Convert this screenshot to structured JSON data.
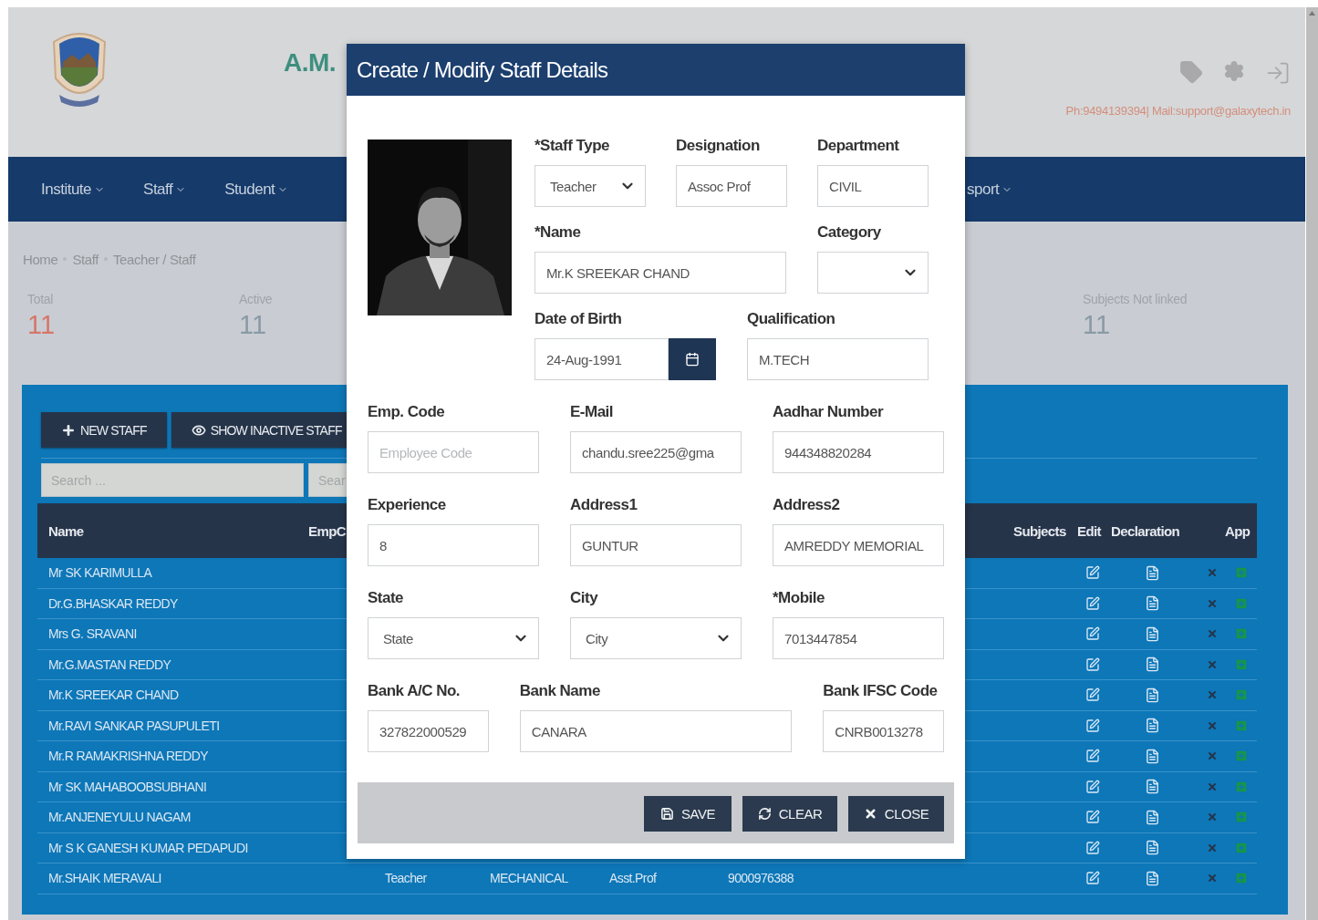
{
  "header": {
    "school_name": "A.M.",
    "contact": "Ph:9494139394| Mail:support@galaxytech.in"
  },
  "nav": [
    {
      "label": "Institute"
    },
    {
      "label": "Staff"
    },
    {
      "label": "Student"
    },
    {
      "label": "sport"
    }
  ],
  "breadcrumb": [
    "Home",
    "Staff",
    "Teacher / Staff"
  ],
  "stats": [
    {
      "label": "Total",
      "value": "11",
      "kind": "alert"
    },
    {
      "label": "Active",
      "value": "11",
      "kind": "plain"
    },
    {
      "label": "Subjects Not linked",
      "value": "11",
      "kind": "plain"
    }
  ],
  "toolbar": [
    {
      "label": "NEW STAFF",
      "kind": "new"
    },
    {
      "label": "SHOW INACTIVE STAFF",
      "kind": "show"
    }
  ],
  "search_fields": [
    {
      "placeholder": "Search ..."
    },
    {
      "placeholder": "Sear"
    }
  ],
  "table": {
    "columns_left": [
      "Name",
      "EmpC"
    ],
    "columns_right": [
      "Subjects",
      "Edit",
      "Declaration",
      "App"
    ],
    "rows": [
      {
        "name": "Mr SK KARIMULLA"
      },
      {
        "name": "Dr.G.BHASKAR REDDY"
      },
      {
        "name": "Mrs G. SRAVANI"
      },
      {
        "name": "Mr.G.MASTAN REDDY"
      },
      {
        "name": "Mr.K SREEKAR CHAND"
      },
      {
        "name": "Mr.RAVI SANKAR PASUPULETI"
      },
      {
        "name": "Mr.R RAMAKRISHNA REDDY"
      },
      {
        "name": "Mr SK MAHABOOBSUBHANI"
      },
      {
        "name": "Mr.ANJENEYULU NAGAM"
      },
      {
        "name": "Mr S K GANESH KUMAR PEDAPUDI"
      },
      {
        "name": "Mr.SHAIK MERAVALI",
        "cells": [
          "Teacher",
          "MECHANICAL",
          "Asst.Prof",
          "9000976388"
        ]
      }
    ]
  },
  "modal": {
    "title": "Create / Modify Staff Details",
    "top_rows": [
      [
        {
          "label": "*Staff Type",
          "kind": "select",
          "value": "Teacher"
        },
        {
          "label": "Designation",
          "kind": "text",
          "value": "Assoc Prof"
        },
        {
          "label": "Department",
          "kind": "text",
          "value": "CIVIL"
        }
      ],
      [
        {
          "label": "*Name",
          "kind": "text",
          "value": "Mr.K SREEKAR CHAND"
        },
        {
          "label": "Category",
          "kind": "select"
        }
      ],
      [
        {
          "label": "Date of Birth",
          "kind": "date",
          "value": "24-Aug-1991"
        },
        {
          "label": "Qualification",
          "kind": "text",
          "value": "M.TECH"
        }
      ]
    ],
    "rows": [
      [
        {
          "label": "Emp. Code",
          "kind": "text",
          "placeholder": "Employee Code"
        },
        {
          "label": "E-Mail",
          "kind": "text",
          "value": "chandu.sree225@gma"
        },
        {
          "label": "Aadhar Number",
          "kind": "text",
          "value": "944348820284"
        }
      ],
      [
        {
          "label": "Experience",
          "kind": "text",
          "value": "8"
        },
        {
          "label": "Address1",
          "kind": "text",
          "value": "GUNTUR"
        },
        {
          "label": "Address2",
          "kind": "text",
          "value": "AMREDDY MEMORIAL"
        }
      ],
      [
        {
          "label": "State",
          "kind": "select",
          "value": "State"
        },
        {
          "label": "City",
          "kind": "select",
          "value": "City"
        },
        {
          "label": "*Mobile",
          "kind": "text",
          "value": "7013447854"
        }
      ],
      [
        {
          "label": "Bank A/C No.",
          "kind": "text",
          "value": "327822000529"
        },
        {
          "label": "Bank Name",
          "kind": "text",
          "value": "CANARA"
        },
        {
          "label": "Bank IFSC Code",
          "kind": "text",
          "value": "CNRB0013278"
        }
      ]
    ],
    "buttons": [
      {
        "label": "SAVE",
        "kind": "save"
      },
      {
        "label": "CLEAR",
        "kind": "clear"
      },
      {
        "label": "CLOSE",
        "kind": "close"
      }
    ]
  }
}
